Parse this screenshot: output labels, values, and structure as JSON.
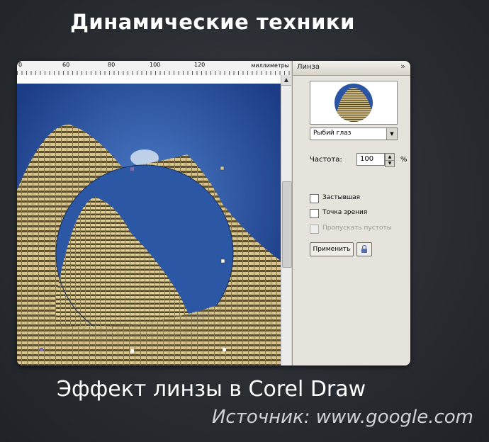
{
  "slide": {
    "title": "Динамические техники",
    "caption": "Эффект линзы в Corel Draw",
    "source": "Источник: www.google.com"
  },
  "ruler": {
    "labels": [
      "0",
      "60",
      "80",
      "100",
      "120"
    ],
    "unit": "миллиметры"
  },
  "docker": {
    "title": "Линза",
    "chevron": "»",
    "lens_type": "Рыбий глаз",
    "frequency_label": "Частота:",
    "frequency_value": "100",
    "frequency_unit": "%",
    "options": [
      {
        "label": "Застывшая",
        "checked": false,
        "enabled": true
      },
      {
        "label": "Точка зрения",
        "checked": false,
        "enabled": true
      },
      {
        "label": "Пропускать пустоты",
        "checked": false,
        "enabled": false
      }
    ],
    "apply_label": "Применить"
  },
  "colors": {
    "sky": "#2a55a5",
    "building": "#c9b27a",
    "panel": "#e6e3dc"
  }
}
